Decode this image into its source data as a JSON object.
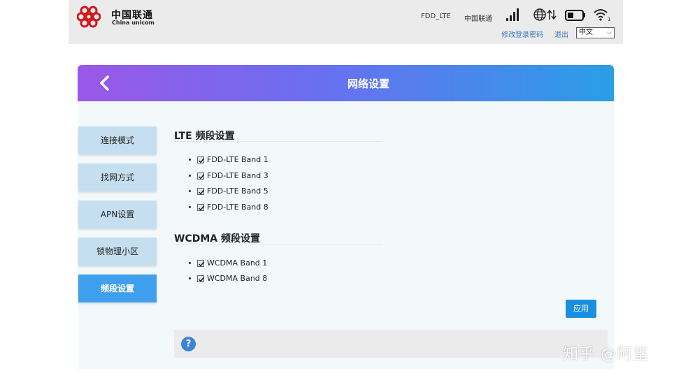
{
  "brand": {
    "name_cn": "中国联通",
    "name_en": "China unicom",
    "color": "#d4161c"
  },
  "status": {
    "network": "FDD_LTE",
    "carrier": "中国联通",
    "icons": [
      "signal-icon",
      "globe-data-icon",
      "battery-icon",
      "wifi-icon"
    ]
  },
  "header_links": {
    "change_password": "修改登录密码",
    "logout": "退出"
  },
  "language": {
    "selected": "中文"
  },
  "page": {
    "title": "网络设置"
  },
  "sidebar": {
    "items": [
      {
        "label": "连接模式",
        "active": false
      },
      {
        "label": "找网方式",
        "active": false
      },
      {
        "label": "APN设置",
        "active": false
      },
      {
        "label": "锁物理小区",
        "active": false
      },
      {
        "label": "频段设置",
        "active": true
      }
    ]
  },
  "lte": {
    "title": "LTE 频段设置",
    "bands": [
      {
        "label": "FDD-LTE Band 1",
        "checked": true
      },
      {
        "label": "FDD-LTE Band 3",
        "checked": true
      },
      {
        "label": "FDD-LTE Band 5",
        "checked": true
      },
      {
        "label": "FDD-LTE Band 8",
        "checked": true
      }
    ]
  },
  "wcdma": {
    "title": "WCDMA 频段设置",
    "bands": [
      {
        "label": "WCDMA Band 1",
        "checked": true
      },
      {
        "label": "WCDMA Band 8",
        "checked": true
      }
    ]
  },
  "actions": {
    "apply": "应用"
  },
  "help": {
    "icon": "help-icon",
    "glyph": "?"
  },
  "watermark": "知乎 @阿玺",
  "colors": {
    "accent": "#1a8fe0",
    "active_tab": "#3fa0ef",
    "tab": "#c6dff0",
    "gradient_start": "#9b58e8",
    "gradient_end": "#2a9ee6"
  }
}
